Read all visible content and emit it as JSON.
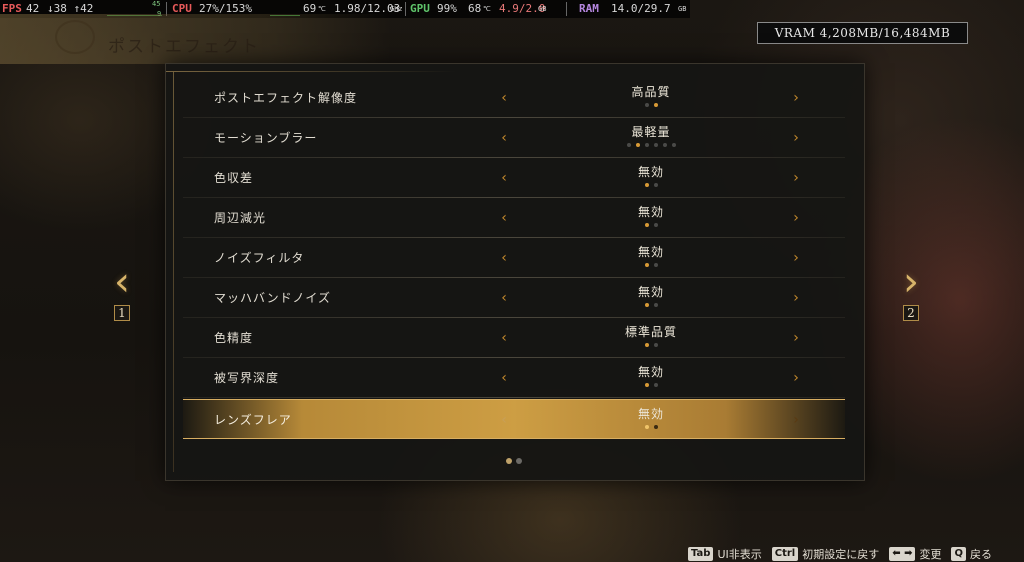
{
  "perf": {
    "fps_label": "FPS",
    "fps_value": "42",
    "frame_times": "↓38 ↑42",
    "graph_max": "45",
    "graph_min": "9",
    "cpu_label": "CPU",
    "cpu_value": "27%/153%",
    "cpu_temp": "69",
    "cpu_temp_unit": "℃",
    "cpu_clock": "1.98/12.03",
    "cpu_clock_unit": "GHz",
    "gpu_label": "GPU",
    "gpu_value": "99%",
    "gpu_temp": "68",
    "gpu_temp_unit": "℃",
    "gpu_mem": "4.9/2.0",
    "gpu_mem_unit": "GB",
    "ram_label": "RAM",
    "ram_value": "14.0/29.7",
    "ram_unit": "GB"
  },
  "header": {
    "title": "ポストエフェクト"
  },
  "vram": {
    "text": "VRAM 4,208MB/16,484MB"
  },
  "settings": [
    {
      "label": "ポストエフェクト解像度",
      "value": "高品質",
      "dots": 2,
      "active": 1
    },
    {
      "label": "モーションブラー",
      "value": "最軽量",
      "dots": 6,
      "active": 1
    },
    {
      "label": "色収差",
      "value": "無効",
      "dots": 2,
      "active": 0
    },
    {
      "label": "周辺減光",
      "value": "無効",
      "dots": 2,
      "active": 0
    },
    {
      "label": "ノイズフィルタ",
      "value": "無効",
      "dots": 2,
      "active": 0
    },
    {
      "label": "マッハバンドノイズ",
      "value": "無効",
      "dots": 2,
      "active": 0
    },
    {
      "label": "色精度",
      "value": "標準品質",
      "dots": 2,
      "active": 0
    },
    {
      "label": "被写界深度",
      "value": "無効",
      "dots": 2,
      "active": 0
    },
    {
      "label": "レンズフレア",
      "value": "無効",
      "dots": 2,
      "active": 0,
      "selected": true
    }
  ],
  "arrows": {
    "left": "‹",
    "right": "›"
  },
  "pagination": {
    "pages": 2,
    "current": 1
  },
  "side_nav": {
    "prev_chevron": "‹",
    "prev_num": "1",
    "next_chevron": "›",
    "next_num": "2"
  },
  "hints": [
    {
      "key": "Tab",
      "text": "UI非表示"
    },
    {
      "key": "Ctrl",
      "text": "初期設定に戻す"
    },
    {
      "key": "⬅ ➡",
      "text": "変更"
    },
    {
      "key": "Q",
      "text": "戻る"
    }
  ]
}
